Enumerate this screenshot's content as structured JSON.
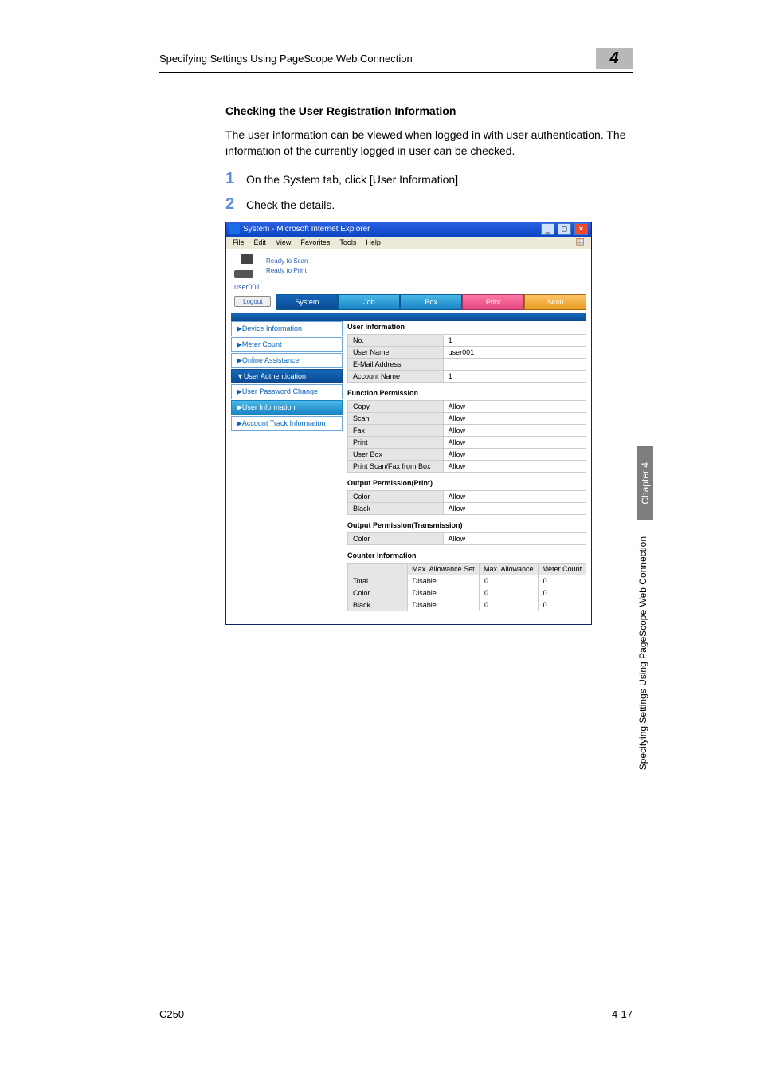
{
  "header": {
    "left": "Specifying Settings Using PageScope Web Connection",
    "badge": "4"
  },
  "section": {
    "title": "Checking the User Registration Information",
    "para": "The user information can be viewed when logged in with user authentication. The information of the currently logged in user can be checked."
  },
  "steps": [
    {
      "num": "1",
      "text": "On the System tab, click [User Information]."
    },
    {
      "num": "2",
      "text": "Check the details."
    }
  ],
  "ie": {
    "title": "System - Microsoft Internet Explorer",
    "menus": [
      "File",
      "Edit",
      "View",
      "Favorites",
      "Tools",
      "Help"
    ],
    "status1": "Ready to Scan",
    "status2": "Ready to Print",
    "user": "user001",
    "logout": "Logout",
    "tabs": {
      "system": "System",
      "job": "Job",
      "box": "Box",
      "print": "Print",
      "scan": "Scan"
    },
    "side": {
      "items": [
        {
          "label": "▶Device Information",
          "cls": "item"
        },
        {
          "label": "▶Meter Count",
          "cls": "item"
        },
        {
          "label": "▶Online Assistance",
          "cls": "item"
        },
        {
          "label": "▼User Authentication",
          "cls": "item dark"
        },
        {
          "label": "  ▶User Password Change",
          "cls": "item"
        },
        {
          "label": "▶User Information",
          "cls": "item active"
        },
        {
          "label": "▶Account Track Information",
          "cls": "item"
        }
      ]
    },
    "panels": {
      "userInfo": {
        "heading": "User Information",
        "rows": [
          {
            "k": "No.",
            "v": "1"
          },
          {
            "k": "User Name",
            "v": "user001"
          },
          {
            "k": "E-Mail Address",
            "v": ""
          },
          {
            "k": "Account Name",
            "v": "1"
          }
        ]
      },
      "funcPerm": {
        "heading": "Function Permission",
        "rows": [
          {
            "k": "Copy",
            "v": "Allow"
          },
          {
            "k": "Scan",
            "v": "Allow"
          },
          {
            "k": "Fax",
            "v": "Allow"
          },
          {
            "k": "Print",
            "v": "Allow"
          },
          {
            "k": "User Box",
            "v": "Allow"
          },
          {
            "k": "Print Scan/Fax from Box",
            "v": "Allow"
          }
        ]
      },
      "outPrint": {
        "heading": "Output Permission(Print)",
        "rows": [
          {
            "k": "Color",
            "v": "Allow"
          },
          {
            "k": "Black",
            "v": "Allow"
          }
        ]
      },
      "outTrans": {
        "heading": "Output Permission(Transmission)",
        "rows": [
          {
            "k": "Color",
            "v": "Allow"
          }
        ]
      },
      "counter": {
        "heading": "Counter Information",
        "head": [
          "",
          "Max. Allowance Set",
          "Max. Allowance",
          "Meter Count"
        ],
        "rows": [
          {
            "k": "Total",
            "a": "Disable",
            "b": "0",
            "c": "0"
          },
          {
            "k": "Color",
            "a": "Disable",
            "b": "0",
            "c": "0"
          },
          {
            "k": "Black",
            "a": "Disable",
            "b": "0",
            "c": "0"
          }
        ]
      }
    }
  },
  "sideTab": {
    "chapter": "Chapter 4",
    "long": "Specifying Settings Using PageScope Web Connection"
  },
  "footer": {
    "left": "C250",
    "right": "4-17"
  }
}
